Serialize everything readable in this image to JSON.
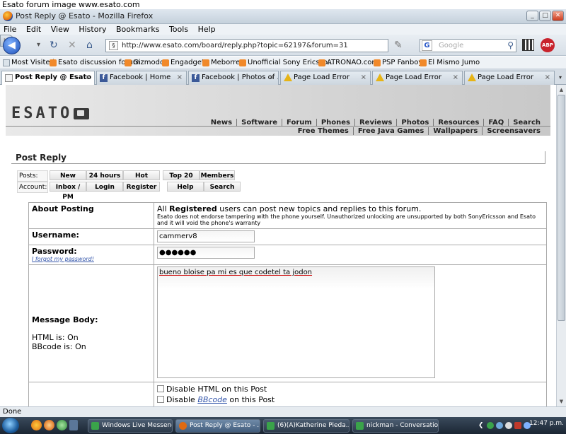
{
  "caption": "Esato forum image www.esato.com",
  "window": {
    "title": "Post Reply @ Esato - Mozilla Firefox",
    "minimize_glyph": "_",
    "maximize_glyph": "□",
    "close_glyph": "✕"
  },
  "menu": [
    "File",
    "Edit",
    "View",
    "History",
    "Bookmarks",
    "Tools",
    "Help"
  ],
  "nav": {
    "back_glyph": "◀",
    "forward_glyph": "▶",
    "dropdown_glyph": "▾",
    "reload_glyph": "↻",
    "stop_glyph": "✕",
    "home_glyph": "⌂",
    "url": "http://www.esato.com/board/reply.php?topic=62197&forum=31",
    "url_favicon": "§",
    "rss_glyph": "))",
    "star_glyph": "☆",
    "search_engine_glyph": "G",
    "search_placeholder": "Google",
    "search_glyph": "⚲",
    "abp_label": "ABP"
  },
  "bookmarks": [
    "Most Visited",
    "Esato discussion forum",
    "Gizmodo",
    "Engadget",
    "Meborre",
    "Unofficial Sony Ericsso...",
    "ATRONAO.com",
    "PSP Fanboy",
    "El Mismo Jumo"
  ],
  "tabs": [
    {
      "label": "Post Reply @ Esato",
      "active": true
    },
    {
      "label": "Facebook | Home"
    },
    {
      "label": "Facebook | Photos of ..."
    },
    {
      "label": "Page Load Error"
    },
    {
      "label": "Page Load Error"
    },
    {
      "label": "Page Load Error"
    }
  ],
  "tab_close_glyph": "×",
  "tab_more_glyph": "▾",
  "site": {
    "logo": "ESATO",
    "nav_row1": [
      "News",
      "Software",
      "Forum",
      "Phones",
      "Reviews",
      "Photos",
      "Resources",
      "FAQ",
      "Search"
    ],
    "nav_row2": [
      "Free Themes",
      "Free Java Games",
      "Wallpapers",
      "Screensavers"
    ],
    "heading": "Post Reply",
    "posts_label": "Posts:",
    "posts_buttons": [
      "New posts",
      "24 hours",
      "Hot",
      "Top 20",
      "Members"
    ],
    "account_label": "Account:",
    "account_buttons": [
      "Inbox / PM",
      "Login",
      "Register",
      "Help",
      "Search"
    ]
  },
  "form": {
    "about_label": "About Posting",
    "about_prefix": "All ",
    "about_bold": "Registered",
    "about_suffix": " users can post new topics and replies to this forum.",
    "about_note": "Esato does not endorse tampering with the phone yourself. Unauthorized unlocking are unsupported by both SonyEricsson and Esato and it will void the phone's warranty",
    "username_label": "Username:",
    "username_value": "cammerv8",
    "password_label": "Password:",
    "password_value": "●●●●●●",
    "forgot_password": "I forgot my password!",
    "message_label": "Message Body:",
    "html_status": "HTML is: On",
    "bbcode_status": "BBcode is: On",
    "message_value": "bueno bloise pa mi es que codetel ta jodon",
    "disable_html_prefix": "Disable ",
    "disable_html_label": "HTML",
    "disable_html_suffix": " on this Post",
    "disable_bb_prefix": "Disable ",
    "disable_bb_link": "BBcode",
    "disable_bb_suffix": " on this Post"
  },
  "status": "Done",
  "taskbar": {
    "buttons": [
      {
        "label": "Windows Live Messenger",
        "color": "#3aa34a"
      },
      {
        "label": "Post Reply @ Esato - ...",
        "color": "#e06a12",
        "active": true
      },
      {
        "label": "(6)(A)Katherine Pieda...",
        "color": "#3aa34a"
      },
      {
        "label": "nickman - Conversation",
        "color": "#3aa34a"
      }
    ],
    "tray_glyph": "❮",
    "clock": "12:47 p.m."
  }
}
